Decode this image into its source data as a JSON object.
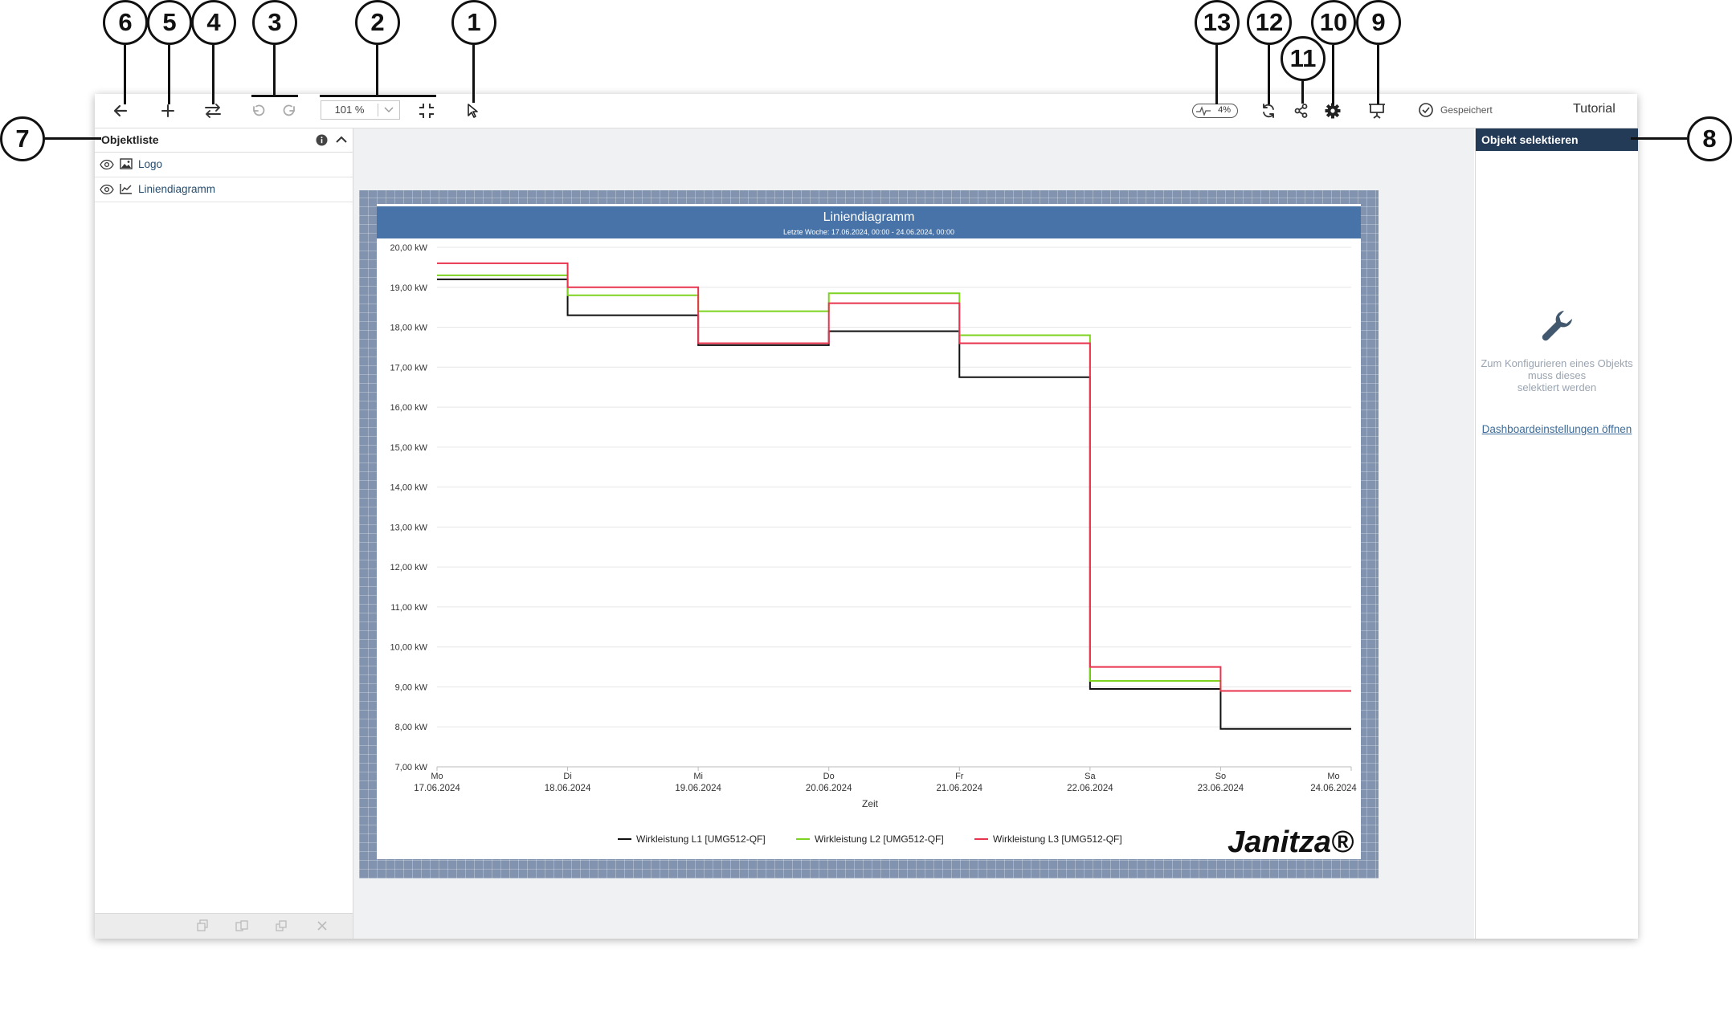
{
  "callouts": [
    "1",
    "2",
    "3",
    "4",
    "5",
    "6",
    "7",
    "8",
    "9",
    "10",
    "11",
    "12",
    "13"
  ],
  "toolbar": {
    "zoom_value": "101 %",
    "cpu_load": "4%",
    "saved_label": "Gespeichert",
    "tutorial_label": "Tutorial"
  },
  "object_list": {
    "title": "Objektliste",
    "items": [
      {
        "label": "Logo",
        "icon": "image-icon"
      },
      {
        "label": "Liniendiagramm",
        "icon": "line-chart-icon"
      }
    ]
  },
  "right_panel": {
    "title": "Objekt selektieren",
    "message_line1": "Zum Konfigurieren eines Objekts muss dieses",
    "message_line2": "selektiert werden",
    "link": "Dashboardeinstellungen öffnen"
  },
  "colors": {
    "series_l1": "#111111",
    "series_l2": "#7ed321",
    "series_l3": "#e8344e",
    "chart_header": "#4773a8",
    "panel_header": "#243b57"
  },
  "chart_data": {
    "type": "line",
    "step": true,
    "title": "Liniendiagramm",
    "subtitle": "Letzte Woche: 17.06.2024, 00:00 - 24.06.2024, 00:00",
    "xlabel": "Zeit",
    "ylabel": "",
    "ylim": [
      7,
      20
    ],
    "yticks": [
      "20,00 kW",
      "19,00 kW",
      "18,00 kW",
      "17,00 kW",
      "16,00 kW",
      "15,00 kW",
      "14,00 kW",
      "13,00 kW",
      "12,00 kW",
      "11,00 kW",
      "10,00 kW",
      "9,00 kW",
      "8,00 kW",
      "7,00 kW"
    ],
    "xticks": [
      {
        "day": "Mo",
        "date": "17.06.2024"
      },
      {
        "day": "Di",
        "date": "18.06.2024"
      },
      {
        "day": "Mi",
        "date": "19.06.2024"
      },
      {
        "day": "Do",
        "date": "20.06.2024"
      },
      {
        "day": "Fr",
        "date": "21.06.2024"
      },
      {
        "day": "Sa",
        "date": "22.06.2024"
      },
      {
        "day": "So",
        "date": "23.06.2024"
      },
      {
        "day": "Mo",
        "date": "24.06.2024"
      }
    ],
    "grid": true,
    "legend_position": "bottom",
    "series": [
      {
        "name": "Wirkleistung L1 [UMG512-QF]",
        "values": [
          19.2,
          18.3,
          17.55,
          17.9,
          16.75,
          8.95,
          7.95
        ]
      },
      {
        "name": "Wirkleistung L2 [UMG512-QF]",
        "values": [
          19.3,
          18.8,
          18.4,
          18.85,
          17.8,
          9.15,
          8.9
        ]
      },
      {
        "name": "Wirkleistung L3 [UMG512-QF]",
        "values": [
          19.6,
          19.0,
          17.6,
          18.6,
          17.6,
          9.5,
          8.9
        ]
      }
    ],
    "logo_text": "Janitza®"
  }
}
